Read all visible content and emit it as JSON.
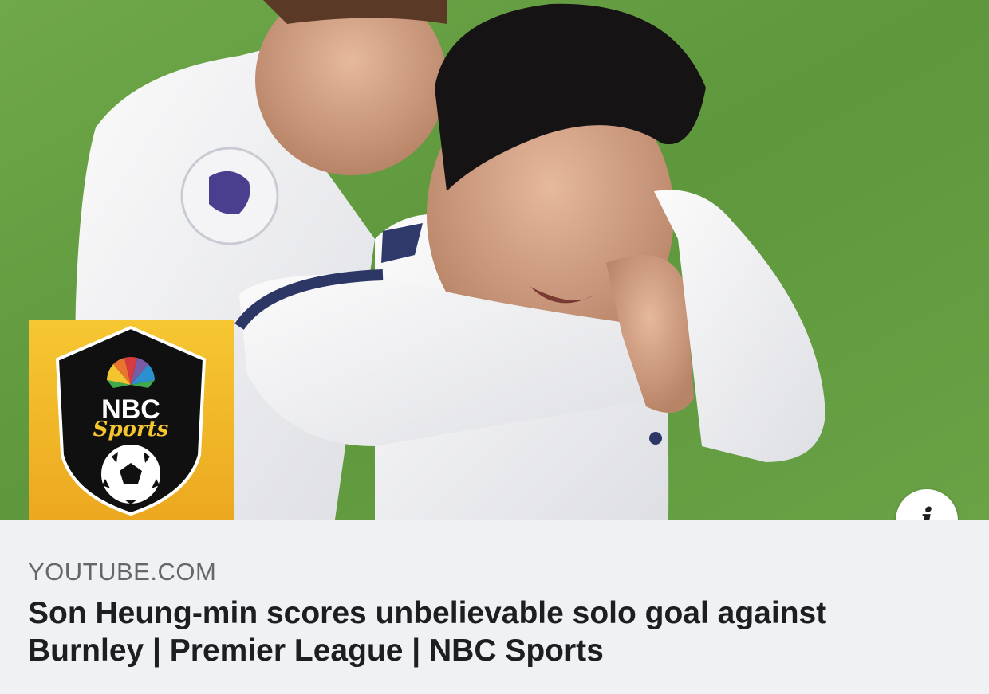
{
  "link_preview": {
    "source_domain": "YOUTUBE.COM",
    "title": "Son Heung-min scores unbelievable solo goal against Burnley | Premier League | NBC Sports",
    "info_button": "i"
  },
  "logo": {
    "line1": "NBC",
    "line2": "Sports",
    "tile_color": "#f2b828",
    "shield_color": "#0f0f0f"
  },
  "colors": {
    "pitch": "#5f9a3e",
    "card_bg": "#f0f1f3",
    "title_text": "#1c1e21",
    "domain_text": "#65676b"
  },
  "icons": [
    "info-icon",
    "nbc-peacock-icon",
    "soccer-ball-icon",
    "premier-league-lion-icon"
  ]
}
